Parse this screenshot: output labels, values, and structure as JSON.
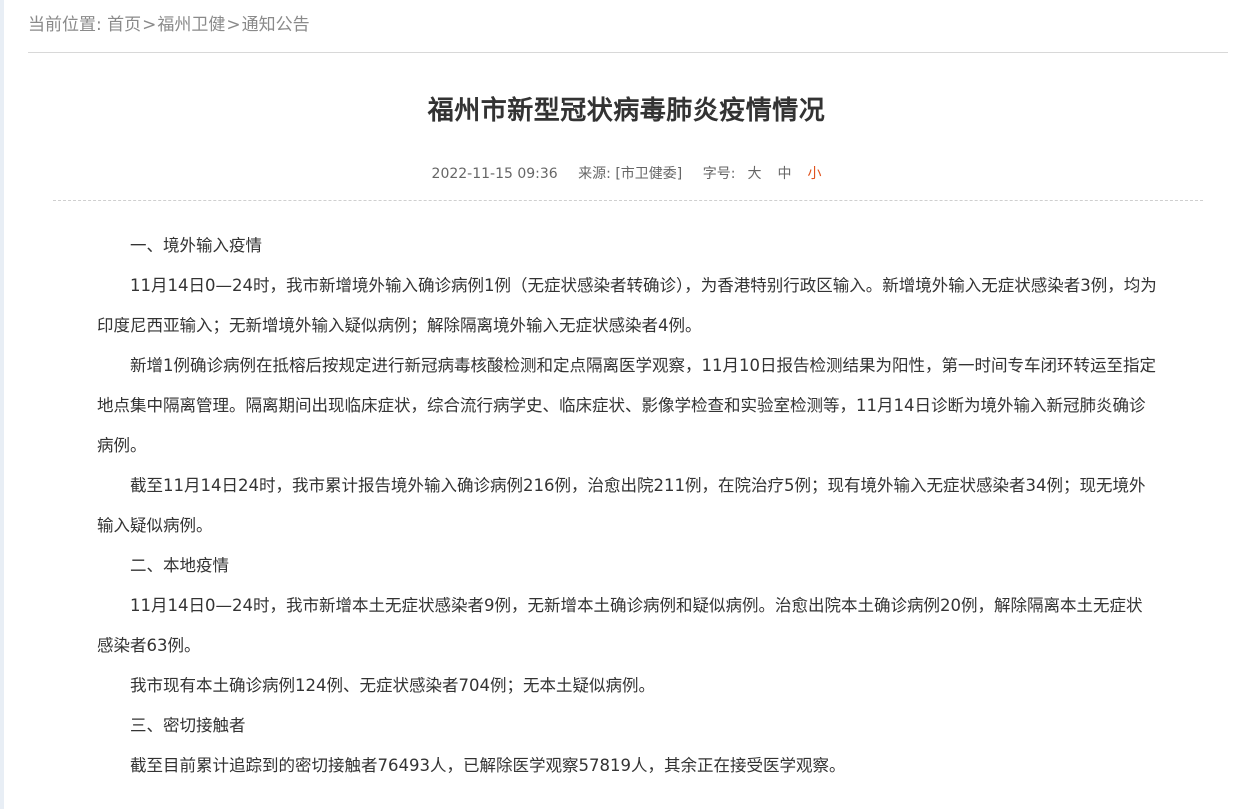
{
  "breadcrumb": {
    "prefix": "当前位置:",
    "items": [
      "首页",
      "福州卫健",
      "通知公告"
    ],
    "separator": ">"
  },
  "article": {
    "title": "福州市新型冠状病毒肺炎疫情情况",
    "date": "2022-11-15 09:36",
    "source": "来源: [市卫健委]",
    "font_size_label": "字号:",
    "font_sizes": [
      "大",
      "中",
      "小"
    ],
    "active_font_size": "小",
    "paragraphs": [
      "一、境外输入疫情",
      "11月14日0—24时，我市新增境外输入确诊病例1例（无症状感染者转确诊），为香港特别行政区输入。新增境外输入无症状感染者3例，均为印度尼西亚输入；无新增境外输入疑似病例；解除隔离境外输入无症状感染者4例。",
      "新增1例确诊病例在抵榕后按规定进行新冠病毒核酸检测和定点隔离医学观察，11月10日报告检测结果为阳性，第一时间专车闭环转运至指定地点集中隔离管理。隔离期间出现临床症状，综合流行病学史、临床症状、影像学检查和实验室检测等，11月14日诊断为境外输入新冠肺炎确诊病例。",
      "截至11月14日24时，我市累计报告境外输入确诊病例216例，治愈出院211例，在院治疗5例；现有境外输入无症状感染者34例；现无境外输入疑似病例。",
      "二、本地疫情",
      "11月14日0—24时，我市新增本土无症状感染者9例，无新增本土确诊病例和疑似病例。治愈出院本土确诊病例20例，解除隔离本土无症状感染者63例。",
      "我市现有本土确诊病例124例、无症状感染者704例；无本土疑似病例。",
      "三、密切接触者",
      "截至目前累计追踪到的密切接触者76493人，已解除医学观察57819人，其余正在接受医学观察。"
    ]
  },
  "colors": {
    "text": "#333333",
    "muted": "#8a8a8a",
    "active_font_size": "#e0531f"
  }
}
